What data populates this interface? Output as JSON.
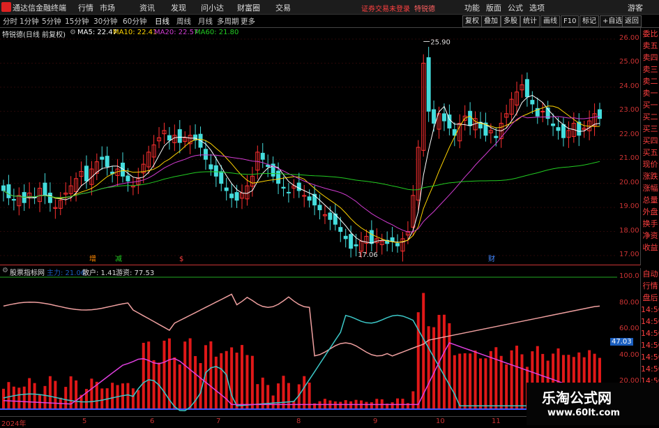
{
  "menubar": {
    "app_title": "通达信金融终端",
    "menus": [
      "行情",
      "市场",
      "资讯",
      "发现",
      "问小达",
      "财富圈",
      "交易"
    ],
    "warning": "证券交易未登录",
    "warning2": "特锐德",
    "right_menus": [
      "功能",
      "版面",
      "公式",
      "选项"
    ],
    "guest": "游客"
  },
  "toolbar": {
    "periods": [
      "分时",
      "1分钟",
      "5分钟",
      "15分钟",
      "30分钟",
      "60分钟",
      "日线",
      "周线",
      "月线",
      "多周期",
      "更多"
    ],
    "active_period": "日线",
    "right_buttons": [
      "复权",
      "叠加",
      "多股",
      "统计",
      "画线",
      "F10",
      "标记",
      "+自选",
      "返回"
    ]
  },
  "infobar": {
    "stock": "特锐德(日线 前复权)",
    "ma5": "MA5: 22.47",
    "ma10": "MA10: 22.41",
    "ma20": "MA20: 22.57",
    "ma60": "MA60: 21.80",
    "colors": {
      "ma5": "#ffffff",
      "ma10": "#ffd400",
      "ma20": "#d23cd2",
      "ma60": "#22cc22"
    }
  },
  "price_axis": [
    "26.00",
    "25.00",
    "24.00",
    "23.00",
    "22.00",
    "21.00",
    "20.00",
    "19.00",
    "18.00",
    "17.00"
  ],
  "annotations": {
    "high": "25.90",
    "low": "17.06"
  },
  "markers": [
    "增",
    "减",
    "$",
    "财"
  ],
  "side_panel": [
    "委比",
    "卖五",
    "卖四",
    "卖三",
    "卖二",
    "卖一",
    "买一",
    "买二",
    "买三",
    "买四",
    "买五",
    "现价",
    "涨跌",
    "涨幅",
    "总量",
    "外盘",
    "换手",
    "净资",
    "收益"
  ],
  "side_panel2": [
    "自动",
    "行情",
    "盘后",
    "14:50",
    "14:50",
    "14:50",
    "14:50",
    "14:50",
    "14:50",
    "14:50",
    "14:50"
  ],
  "subchart": {
    "title": "股票指标网",
    "zhuli": "主力: 21.06",
    "sanhu": "散户: 1.41",
    "youzi": "游资: 77.53",
    "axis": [
      "100.0",
      "80.00",
      "60.00",
      "40.00",
      "20.00"
    ],
    "badge": "47.03"
  },
  "xaxis": [
    "2024年",
    "5",
    "6",
    "7",
    "8",
    "9",
    "10",
    "11"
  ],
  "watermark": {
    "line1": "乐淘公式网",
    "line2": "www.60lt.com"
  },
  "chart_data": {
    "type": "candlestick",
    "title": "特锐德(日线 前复权)",
    "ylim": [
      17.0,
      26.0
    ],
    "closes": [
      19.7,
      19.4,
      19.3,
      19.5,
      19.2,
      19.6,
      19.4,
      19.8,
      19.5,
      19.2,
      19.0,
      19.3,
      19.6,
      19.9,
      20.2,
      20.5,
      20.1,
      20.6,
      20.9,
      21.0,
      20.7,
      20.4,
      20.6,
      20.3,
      20.1,
      19.9,
      20.2,
      20.8,
      21.3,
      21.6,
      21.9,
      22.2,
      21.8,
      22.0,
      21.7,
      21.9,
      22.0,
      21.8,
      21.5,
      21.0,
      20.6,
      20.3,
      20.0,
      19.7,
      19.4,
      19.3,
      19.6,
      19.9,
      20.3,
      21.3,
      21.0,
      20.7,
      20.3,
      20.0,
      19.8,
      19.6,
      19.9,
      19.7,
      19.5,
      19.3,
      19.1,
      18.9,
      18.7,
      18.5,
      18.3,
      18.0,
      17.7,
      17.3,
      17.4,
      17.6,
      17.8,
      17.5,
      17.7,
      17.6,
      17.5,
      17.6,
      17.4,
      17.7,
      18.0,
      19.5,
      21.5,
      25.0,
      23.0,
      22.5,
      22.9,
      22.6,
      22.3,
      22.0,
      22.5,
      22.8,
      22.4,
      22.7,
      22.3,
      22.0,
      22.2,
      21.9,
      22.5,
      22.9,
      23.5,
      23.8,
      24.1,
      23.6,
      23.3,
      22.8,
      23.0,
      22.7,
      22.4,
      22.2,
      21.9,
      22.2,
      22.5,
      22.0,
      22.3,
      22.6,
      22.9,
      22.7
    ],
    "ma_legend": [
      "MA5: 22.47",
      "MA10: 22.41",
      "MA20: 22.57",
      "MA60: 21.80"
    ]
  }
}
